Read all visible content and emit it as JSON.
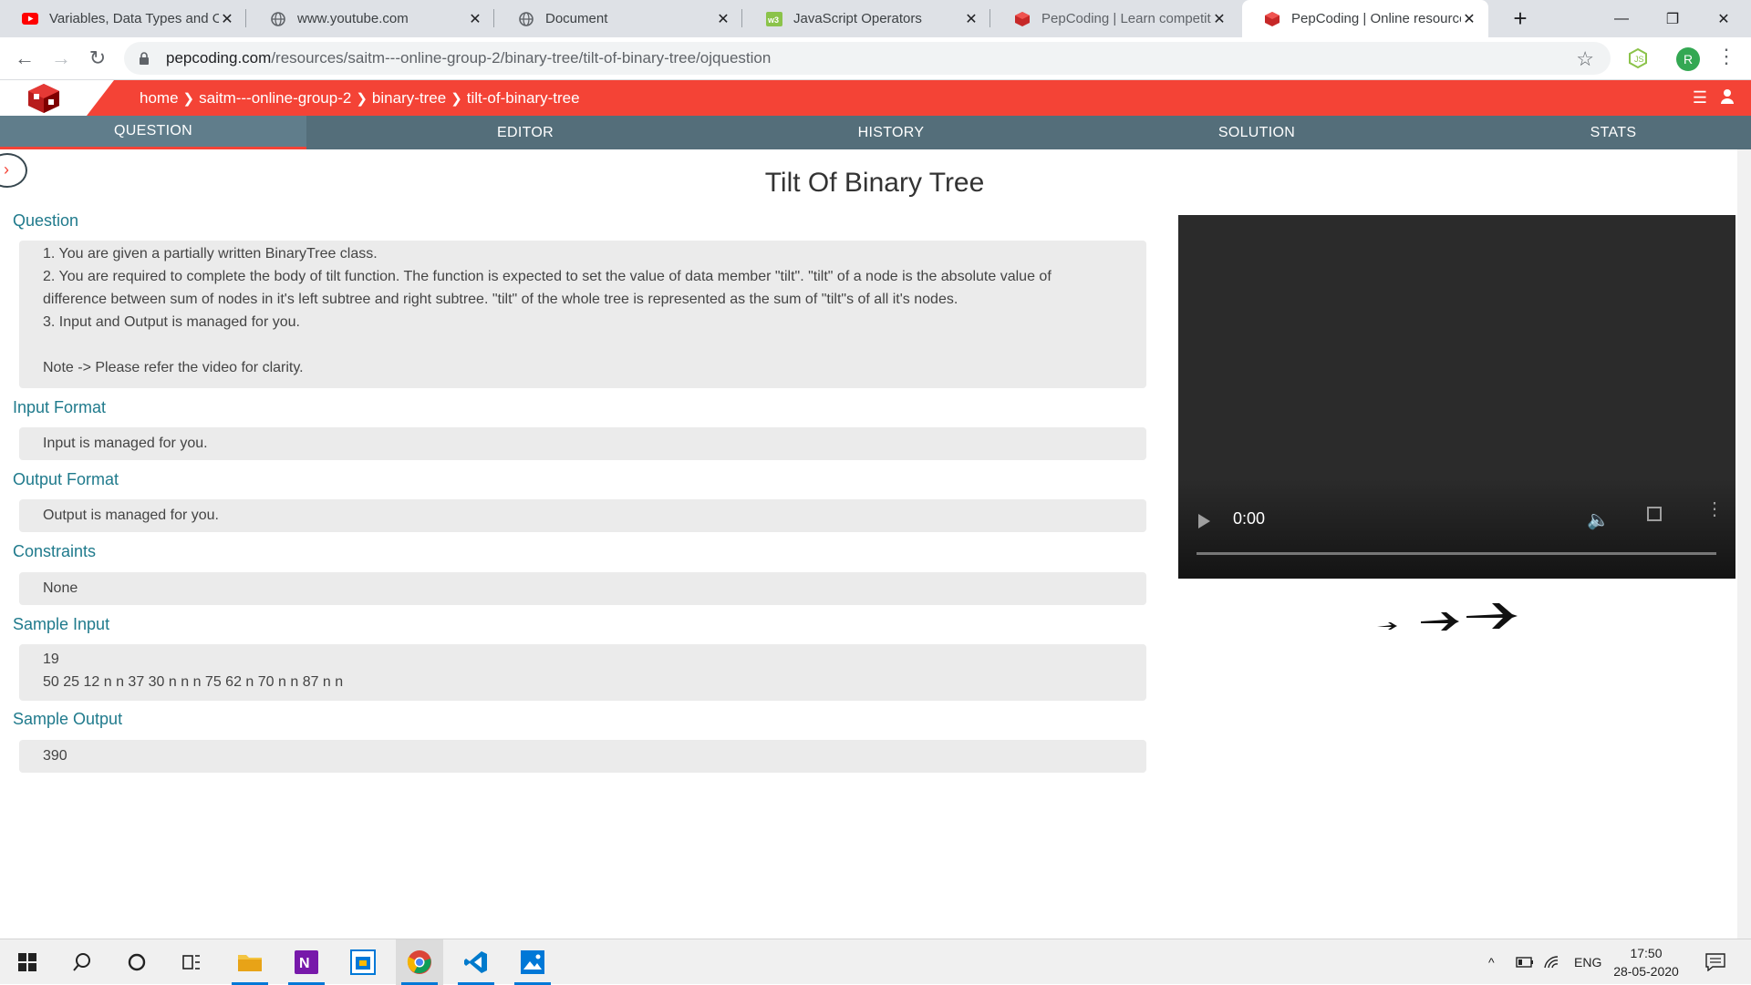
{
  "browser": {
    "tabs": [
      {
        "title": "Variables, Data Types and Op",
        "icon": "youtube-icon"
      },
      {
        "title": "www.youtube.com",
        "icon": "globe-icon"
      },
      {
        "title": "Document",
        "icon": "globe-icon"
      },
      {
        "title": "JavaScript Operators",
        "icon": "w3schools-icon"
      },
      {
        "title": "PepCoding | Learn competiti",
        "icon": "pepcoding-icon"
      },
      {
        "title": "PepCoding | Online resource",
        "icon": "pepcoding-icon",
        "active": true
      }
    ],
    "new_tab": "+",
    "url_domain": "pepcoding.com",
    "url_path": "/resources/saitm---online-group-2/binary-tree/tilt-of-binary-tree/ojquestion",
    "profile_initial": "R"
  },
  "site": {
    "breadcrumb": [
      "home",
      "saitm---online-group-2",
      "binary-tree",
      "tilt-of-binary-tree"
    ],
    "nav_tabs": [
      "QUESTION",
      "EDITOR",
      "HISTORY",
      "SOLUTION",
      "STATS"
    ],
    "active_tab": "QUESTION",
    "accent_color": "#f44336",
    "nav_color": "#546e7a"
  },
  "problem": {
    "title": "Tilt Of Binary Tree",
    "question_label": "Question",
    "question_lines": [
      "1. You are given a partially written BinaryTree class.",
      "2. You are required to complete the body of tilt function. The function is expected to set the value of data member \"tilt\". \"tilt\" of a node is the absolute value of",
      "difference between sum of nodes in it's left subtree and right subtree. \"tilt\" of the whole tree is represented as the sum of \"tilt\"s of all it's nodes.",
      "3. Input and Output is managed for you.",
      "",
      "Note -> Please refer the video for clarity."
    ],
    "input_format_label": "Input Format",
    "input_format": "Input is managed for you.",
    "output_format_label": "Output Format",
    "output_format": "Output is managed for you.",
    "constraints_label": "Constraints",
    "constraints": "None",
    "sample_input_label": "Sample Input",
    "sample_input_lines": [
      "19",
      "50 25 12 n n 37 30 n n n 75 62 n 70 n n 87 n n"
    ],
    "sample_output_label": "Sample Output",
    "sample_output": "390"
  },
  "video": {
    "time": "0:00"
  },
  "taskbar": {
    "lang": "ENG",
    "time": "17:50",
    "date": "28-05-2020"
  }
}
